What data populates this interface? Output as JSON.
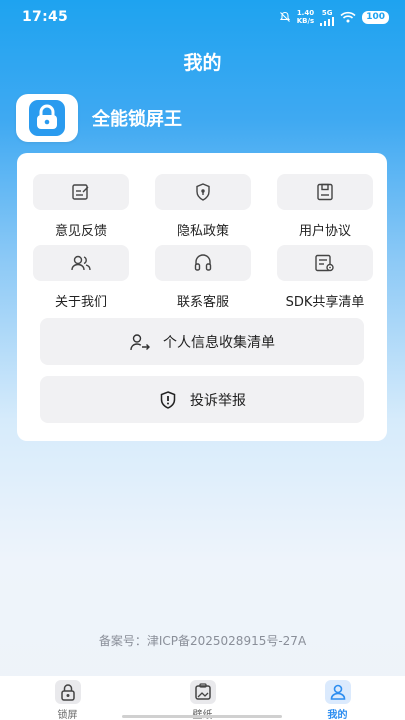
{
  "status_bar": {
    "time": "17:45",
    "net_speed_value": "1.40",
    "net_speed_unit": "KB/s",
    "network_type": "5G",
    "battery": "100"
  },
  "header": {
    "title": "我的"
  },
  "app": {
    "name": "全能锁屏王",
    "icon": "lock-icon"
  },
  "menu": {
    "items": [
      {
        "label": "意见反馈",
        "icon": "feedback-icon"
      },
      {
        "label": "隐私政策",
        "icon": "privacy-shield-icon"
      },
      {
        "label": "用户协议",
        "icon": "agreement-icon"
      },
      {
        "label": "关于我们",
        "icon": "about-us-icon"
      },
      {
        "label": "联系客服",
        "icon": "headset-icon"
      },
      {
        "label": "SDK共享清单",
        "icon": "sdk-list-icon"
      }
    ],
    "personal_info": {
      "label": "个人信息收集清单",
      "icon": "user-info-icon"
    },
    "report": {
      "label": "投诉举报",
      "icon": "report-shield-icon"
    }
  },
  "footer": {
    "icp": "备案号：津ICP备2025028915号-27A"
  },
  "tabbar": {
    "tabs": [
      {
        "label": "锁屏",
        "icon": "lock-tab-icon",
        "active": false
      },
      {
        "label": "壁纸",
        "icon": "wallpaper-tab-icon",
        "active": false
      },
      {
        "label": "我的",
        "icon": "profile-tab-icon",
        "active": true
      }
    ]
  },
  "colors": {
    "accent": "#2c8df0",
    "header_gradient_top": "#1ea3f0",
    "card_bg": "#ffffff",
    "button_bg": "#f1f1f3"
  }
}
